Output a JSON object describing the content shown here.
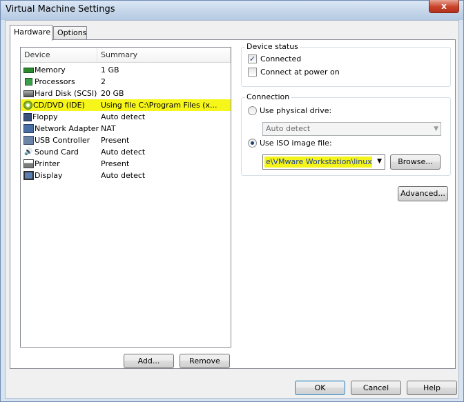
{
  "window": {
    "title": "Virtual Machine Settings",
    "close_glyph": "x"
  },
  "tabs": [
    {
      "label": "Hardware",
      "active": true
    },
    {
      "label": "Options",
      "active": false
    }
  ],
  "device_list": {
    "columns": [
      "Device",
      "Summary"
    ],
    "rows": [
      {
        "icon": "memory-icon",
        "device": "Memory",
        "summary": "1 GB"
      },
      {
        "icon": "processor-icon",
        "device": "Processors",
        "summary": "2"
      },
      {
        "icon": "hard-disk-icon",
        "device": "Hard Disk (SCSI)",
        "summary": "20 GB"
      },
      {
        "icon": "cd-dvd-icon",
        "device": "CD/DVD (IDE)",
        "summary": "Using file C:\\Program Files (x...",
        "selected": true
      },
      {
        "icon": "floppy-icon",
        "device": "Floppy",
        "summary": "Auto detect"
      },
      {
        "icon": "network-adapter-icon",
        "device": "Network Adapter",
        "summary": "NAT"
      },
      {
        "icon": "usb-icon",
        "device": "USB Controller",
        "summary": "Present"
      },
      {
        "icon": "sound-card-icon",
        "device": "Sound Card",
        "summary": "Auto detect"
      },
      {
        "icon": "printer-icon",
        "device": "Printer",
        "summary": "Present"
      },
      {
        "icon": "display-icon",
        "device": "Display",
        "summary": "Auto detect"
      }
    ]
  },
  "list_buttons": {
    "add": "Add...",
    "remove": "Remove"
  },
  "device_status": {
    "label": "Device status",
    "connected": {
      "label": "Connected",
      "checked": true
    },
    "connect_at_power_on": {
      "label": "Connect at power on",
      "checked": false
    }
  },
  "connection": {
    "label": "Connection",
    "physical": {
      "label": "Use physical drive:",
      "selected": false,
      "value": "Auto detect"
    },
    "iso": {
      "label": "Use ISO image file:",
      "selected": true,
      "value": "e\\VMware Workstation\\linux.iso"
    },
    "browse": "Browse..."
  },
  "advanced": "Advanced...",
  "footer": {
    "ok": "OK",
    "cancel": "Cancel",
    "help": "Help"
  },
  "colors": {
    "highlight": "#f6f61a",
    "accent": "#3c7fb1"
  }
}
